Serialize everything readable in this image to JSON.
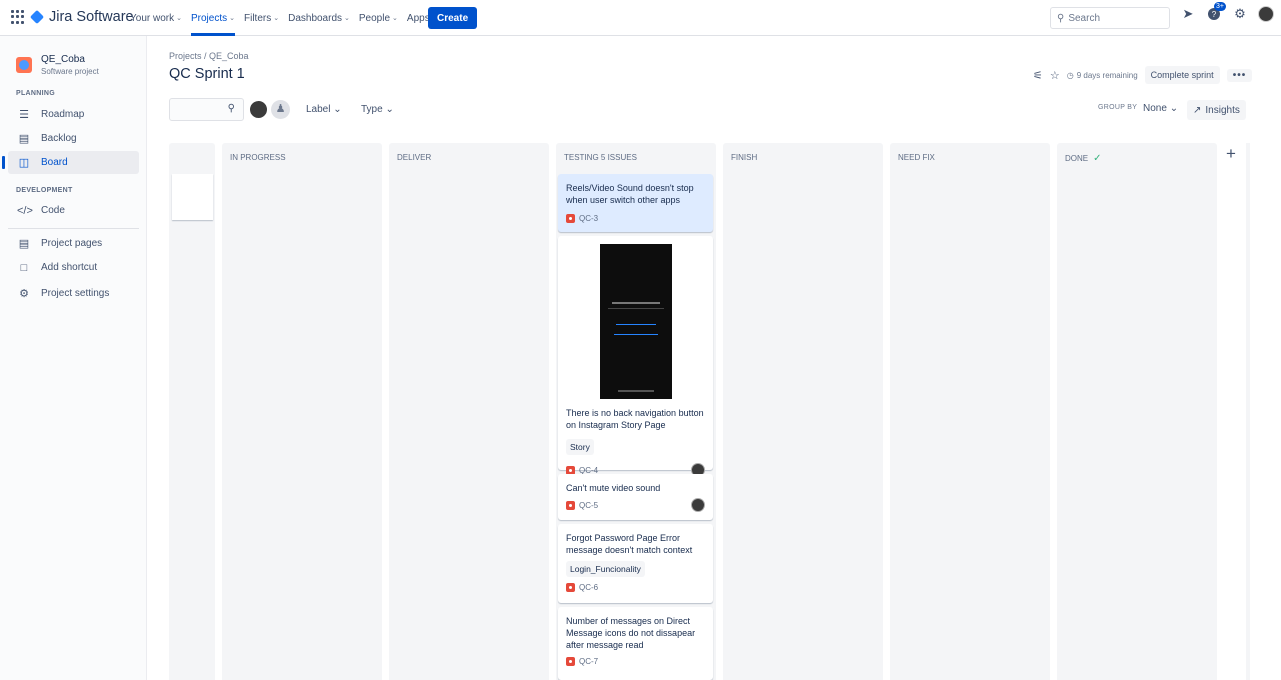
{
  "topnav": {
    "app_name": "Jira Software",
    "items": [
      {
        "label": "Your work",
        "active": false
      },
      {
        "label": "Projects",
        "active": true
      },
      {
        "label": "Filters",
        "active": false
      },
      {
        "label": "Dashboards",
        "active": false
      },
      {
        "label": "People",
        "active": false
      },
      {
        "label": "Apps",
        "active": false
      }
    ],
    "create_label": "Create",
    "search_placeholder": "Search",
    "help_badge": "3+"
  },
  "sidebar": {
    "project_name": "QE_Coba",
    "project_type": "Software project",
    "planning_heading": "PLANNING",
    "development_heading": "DEVELOPMENT",
    "items": [
      {
        "label": "Roadmap",
        "icon": "roadmap-icon"
      },
      {
        "label": "Backlog",
        "icon": "backlog-icon"
      },
      {
        "label": "Board",
        "icon": "board-icon",
        "active": true
      },
      {
        "label": "Code",
        "icon": "code-icon"
      },
      {
        "label": "Project pages",
        "icon": "pages-icon"
      },
      {
        "label": "Add shortcut",
        "icon": "add-shortcut-icon"
      },
      {
        "label": "Project settings",
        "icon": "settings-icon"
      }
    ]
  },
  "header": {
    "breadcrumb": "Projects  /  QE_Coba",
    "title": "QC Sprint 1",
    "days_remaining": "9 days remaining",
    "complete_sprint": "Complete sprint",
    "more": "•••"
  },
  "filters": {
    "label_dropdown": "Label",
    "type_dropdown": "Type",
    "group_by_label": "GROUP BY",
    "group_by_value": "None",
    "insights_label": "Insights"
  },
  "columns": [
    {
      "name": ""
    },
    {
      "name": "IN PROGRESS"
    },
    {
      "name": "DELIVER"
    },
    {
      "name": "TESTING 5 ISSUES"
    },
    {
      "name": "FINISH"
    },
    {
      "name": "NEED FIX"
    },
    {
      "name": "DONE"
    }
  ],
  "cards": [
    {
      "title": "Reels/Video Sound doesn't stop when user switch other apps",
      "key": "QC-3"
    },
    {
      "title": "There is no back navigation button on Instagram Story Page",
      "label": "Story",
      "key": "QC-4"
    },
    {
      "title": "Can't mute video sound",
      "key": "QC-5"
    },
    {
      "title": "Forgot Password Page Error message doesn't match context",
      "label": "Login_Funcionality",
      "key": "QC-6"
    },
    {
      "title": "Number of messages on Direct Message icons do not dissapear after message read",
      "key": "QC-7"
    }
  ],
  "colors": {
    "accent": "#0052cc",
    "bug": "#e5493a",
    "column_bg": "#f4f5f7",
    "done_check": "#36b37e"
  }
}
